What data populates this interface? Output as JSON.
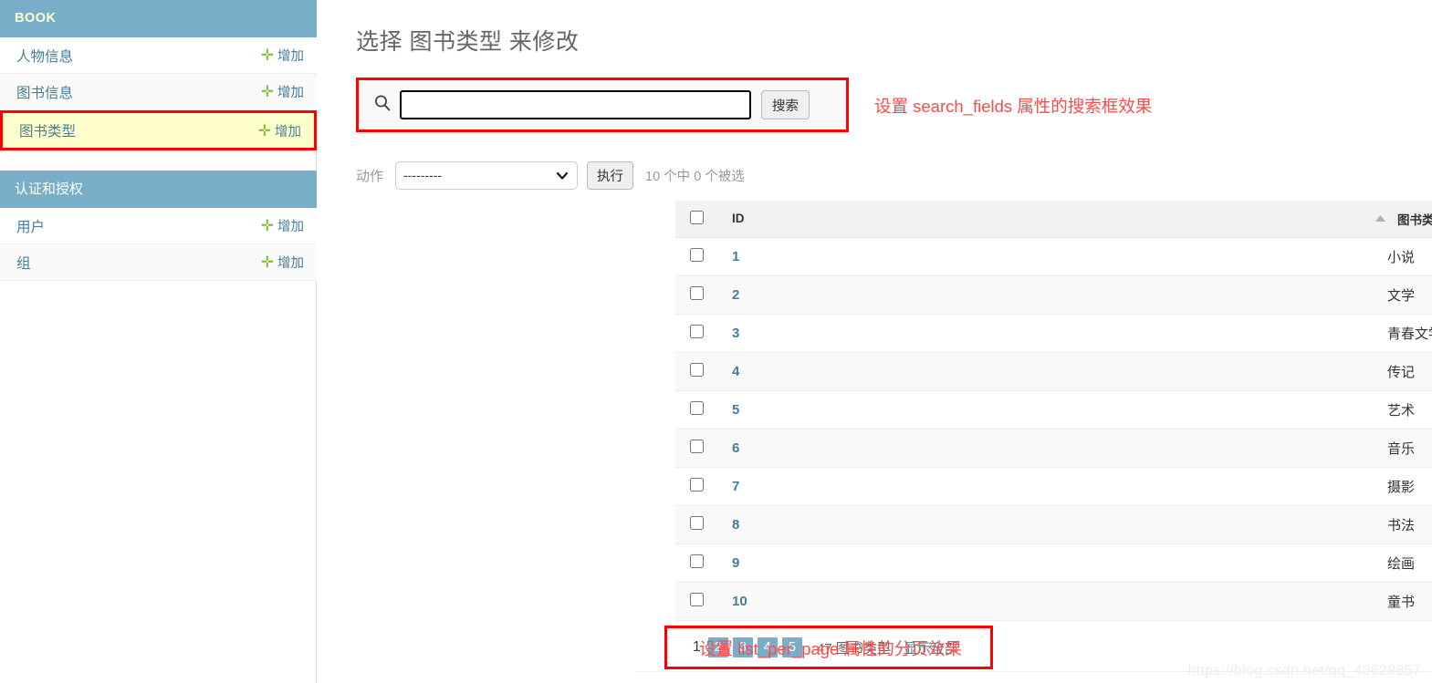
{
  "sidebar": {
    "modules": [
      {
        "caption": "BOOK",
        "style": "book",
        "items": [
          {
            "label": "人物信息",
            "add_label": "增加",
            "add_icon": "plus-icon",
            "current": false
          },
          {
            "label": "图书信息",
            "add_label": "增加",
            "add_icon": "plus-icon",
            "current": false
          },
          {
            "label": "图书类型",
            "add_label": "增加",
            "add_icon": "plus-icon",
            "current": true
          }
        ]
      },
      {
        "caption": "认证和授权",
        "style": "auth",
        "items": [
          {
            "label": "用户",
            "add_label": "增加",
            "add_icon": "plus-icon",
            "current": false
          },
          {
            "label": "组",
            "add_label": "增加",
            "add_icon": "plus-icon",
            "current": false
          }
        ]
      }
    ]
  },
  "main": {
    "page_title": "选择 图书类型 来修改",
    "search": {
      "icon": "search-icon",
      "value": "",
      "placeholder": "",
      "submit_label": "搜索"
    },
    "actions": {
      "label": "动作",
      "selected_option": "---------",
      "options": [
        "---------"
      ],
      "go_label": "执行",
      "counter": "10 个中 0 个被选",
      "chevron_icon": "chevron-down-icon"
    },
    "table": {
      "columns": [
        "ID",
        "图书类型"
      ],
      "sorted_column": "图书类型",
      "sort_direction": "asc",
      "sort_icon": "caret-up-icon",
      "rows": [
        {
          "id": "1",
          "type": "小说"
        },
        {
          "id": "2",
          "type": "文学"
        },
        {
          "id": "3",
          "type": "青春文学"
        },
        {
          "id": "4",
          "type": "传记"
        },
        {
          "id": "5",
          "type": "艺术"
        },
        {
          "id": "6",
          "type": "音乐"
        },
        {
          "id": "7",
          "type": "摄影"
        },
        {
          "id": "8",
          "type": "书法"
        },
        {
          "id": "9",
          "type": "绘画"
        },
        {
          "id": "10",
          "type": "童书"
        }
      ]
    },
    "pagination": {
      "current_page": "1",
      "pages": [
        "2",
        "3",
        "4",
        "5"
      ],
      "total_text": "47 图书类型",
      "show_all_label": "显示全部"
    }
  },
  "annotations": {
    "search_note": "设置 search_fields 属性的搜索框效果",
    "pagination_note": "设置 list_per_page 属性的分页效果"
  },
  "watermark": "https://blog.csdn.net/qq_43629857",
  "colors": {
    "header_blue": "#79aec8",
    "link_blue": "#447e9b",
    "plus_green": "#70bf2b",
    "annotation_red": "#fb4b4b",
    "highlight_border": "#ff0000",
    "highlight_bg": "#ffffcc"
  }
}
